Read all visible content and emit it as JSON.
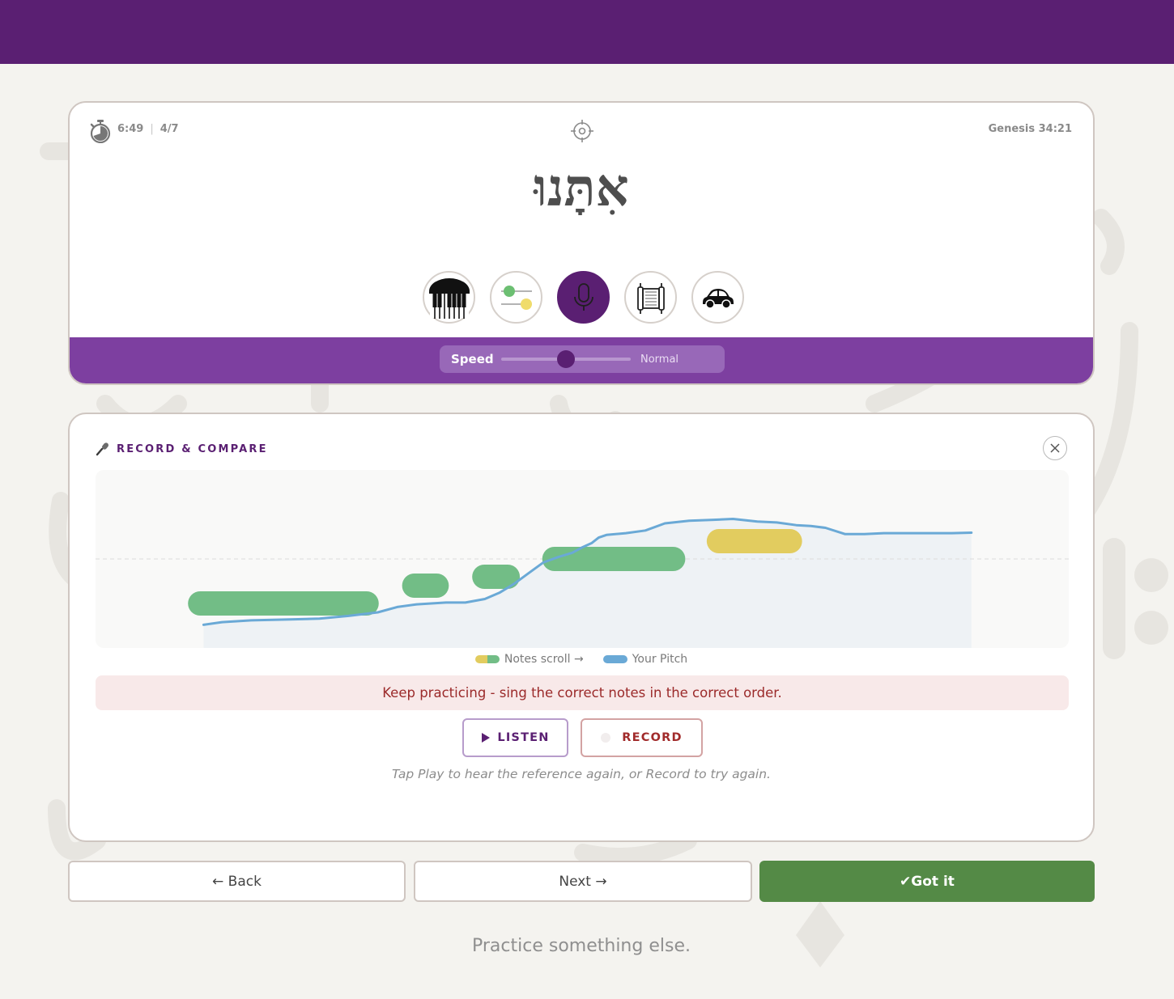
{
  "header": {},
  "word_card": {
    "timer": "6:49",
    "progress": "4/7",
    "reference": "Genesis 34:21",
    "hebrew_word": "אִתָּנוּ",
    "tools": [
      {
        "name": "piano-icon",
        "active": false
      },
      {
        "name": "sliders-icon",
        "active": false
      },
      {
        "name": "microphone-icon",
        "active": true
      },
      {
        "name": "torah-scroll-icon",
        "active": false
      },
      {
        "name": "car-icon",
        "active": false
      }
    ],
    "speed": {
      "label": "Speed",
      "value_label": "Normal",
      "level": 0.5
    }
  },
  "record_card": {
    "title": "RECORD & COMPARE",
    "legend": {
      "notes": "Notes scroll →",
      "pitch": "Your Pitch"
    },
    "feedback": "Keep practicing - sing the correct notes in the correct order.",
    "listen_label": "LISTEN",
    "record_label": "RECORD",
    "hint": "Tap Play to hear the reference again, or Record to try again."
  },
  "nav": {
    "back_label": "← Back",
    "next_label": "Next →",
    "got_it_label": "✔Got it"
  },
  "practice_link": "Practice something else.",
  "colors": {
    "brand_purple": "#5a1f72",
    "speed_bar": "#7d3fa0",
    "note_green": "#72bd86",
    "note_yellow": "#e2cc5f",
    "pitch_blue": "#6aa9d6",
    "got_it_green": "#548a46",
    "feedback_text": "#9b2a2a"
  },
  "chart_data": {
    "type": "line",
    "title": "",
    "xlabel": "",
    "ylabel": "",
    "xlim": [
      0,
      1
    ],
    "ylim": [
      0,
      1
    ],
    "notes": [
      {
        "start": 0.095,
        "end": 0.291,
        "pitch": 0.25,
        "color": "green"
      },
      {
        "start": 0.315,
        "end": 0.363,
        "pitch": 0.35,
        "color": "green"
      },
      {
        "start": 0.387,
        "end": 0.436,
        "pitch": 0.4,
        "color": "green"
      },
      {
        "start": 0.459,
        "end": 0.606,
        "pitch": 0.5,
        "color": "green"
      },
      {
        "start": 0.628,
        "end": 0.726,
        "pitch": 0.6,
        "color": "yellow"
      }
    ],
    "series": [
      {
        "name": "Your Pitch",
        "x": [
          0.111,
          0.13,
          0.16,
          0.2,
          0.23,
          0.26,
          0.29,
          0.31,
          0.33,
          0.36,
          0.38,
          0.4,
          0.415,
          0.43,
          0.445,
          0.46,
          0.475,
          0.49,
          0.5,
          0.51,
          0.517,
          0.525,
          0.545,
          0.565,
          0.585,
          0.61,
          0.635,
          0.655,
          0.68,
          0.7,
          0.72,
          0.735,
          0.75,
          0.77,
          0.79,
          0.81,
          0.85,
          0.88,
          0.9
        ],
        "y": [
          0.13,
          0.145,
          0.155,
          0.16,
          0.165,
          0.18,
          0.2,
          0.23,
          0.245,
          0.255,
          0.255,
          0.275,
          0.31,
          0.36,
          0.42,
          0.48,
          0.51,
          0.535,
          0.565,
          0.59,
          0.62,
          0.635,
          0.645,
          0.66,
          0.7,
          0.715,
          0.72,
          0.725,
          0.71,
          0.705,
          0.69,
          0.685,
          0.675,
          0.64,
          0.64,
          0.645,
          0.645,
          0.645,
          0.648
        ]
      }
    ],
    "reference_line": 0.5,
    "grid": false
  }
}
